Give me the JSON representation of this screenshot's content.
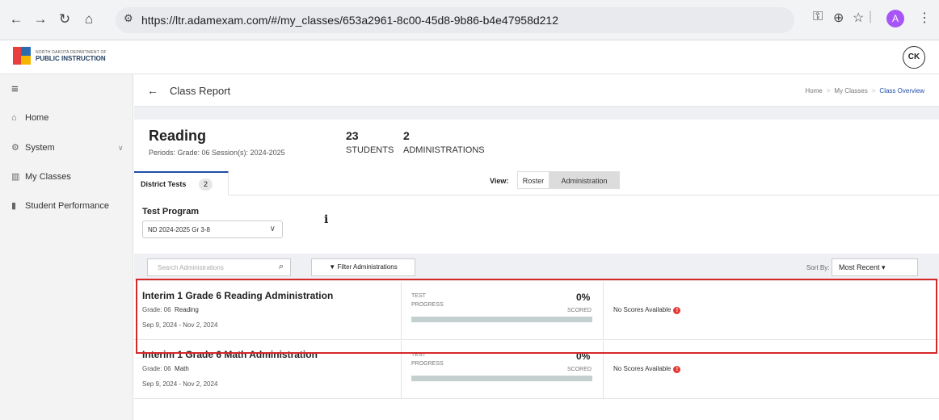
{
  "browser": {
    "url": "https://ltr.adamexam.com/#/my_classes/653a2961-8c00-45d8-9b86-b4e47958d212",
    "profile_initial": "A"
  },
  "header": {
    "logo_line1": "NORTH DAKOTA DEPARTMENT OF",
    "logo_line2": "PUBLIC INSTRUCTION",
    "user_initials": "CK"
  },
  "sidebar": {
    "items": [
      {
        "label": "Home",
        "icon": "home-icon"
      },
      {
        "label": "System",
        "icon": "gear-icon"
      },
      {
        "label": "My Classes",
        "icon": "classes-icon"
      },
      {
        "label": "Student Performance",
        "icon": "bar-chart-icon"
      }
    ]
  },
  "titlebar": {
    "title": "Class Report",
    "breadcrumbs": [
      "Home",
      "My Classes",
      "Class Overview"
    ]
  },
  "class_info": {
    "name": "Reading",
    "meta": "Periods:  Grade: 06   Session(s): 2024-2025",
    "students_count": "23",
    "students_label": "STUDENTS",
    "admins_count": "2",
    "admins_label": "ADMINISTRATIONS"
  },
  "tabs": {
    "district_label": "District Tests",
    "district_count": "2"
  },
  "view": {
    "label": "View:",
    "options": [
      "Roster",
      "Administration"
    ],
    "selected": "Administration"
  },
  "test_program": {
    "label": "Test Program",
    "value": "ND 2024-2025 Gr 3-8"
  },
  "filters": {
    "search_placeholder": "Search Administrations",
    "filter_label": "Filter Administrations",
    "sort_label": "Sort By:",
    "sort_value": "Most Recent"
  },
  "administrations": [
    {
      "name": "Interim 1 Grade 6 Reading Administration",
      "grade": "Grade: 06",
      "subject": "Reading",
      "dates": "Sep 9, 2024 - Nov 2, 2024",
      "progress_label": "TEST\nPROGRESS",
      "percent": "0%",
      "progress_fraction": 0,
      "scored_label": "SCORED",
      "scores_text": "No Scores Available"
    },
    {
      "name": "Interim 1 Grade 6 Math Administration",
      "grade": "Grade: 06",
      "subject": "Math",
      "dates": "Sep 9, 2024 - Nov 2, 2024",
      "progress_label": "TEST\nPROGRESS",
      "percent": "0%",
      "progress_fraction": 0,
      "scored_label": "SCORED",
      "scores_text": "No Scores Available"
    }
  ],
  "colors": {
    "accent": "#1f4ea8",
    "highlight": "#d62828",
    "warning": "#e53935"
  }
}
